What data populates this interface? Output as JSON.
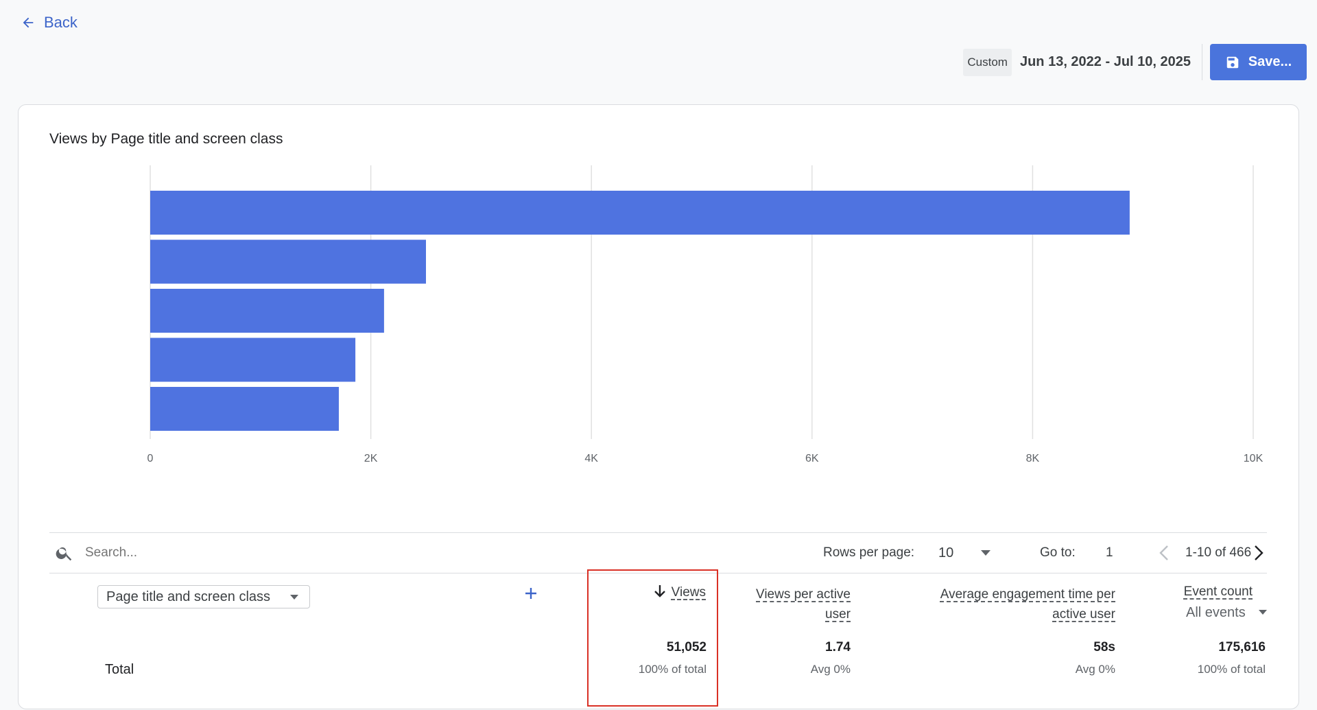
{
  "nav": {
    "back_label": "Back"
  },
  "header": {
    "date_chip": "Custom",
    "date_range": "Jun 13, 2022 - Jul 10, 2025",
    "save_label": "Save..."
  },
  "colors": {
    "accent": "#4a74dc",
    "bar": "#4f73e0",
    "highlight_border": "#d93025"
  },
  "chart_data": {
    "type": "bar",
    "orientation": "horizontal",
    "title": "Views by Page title and screen class",
    "categories": [
      "",
      "",
      "",
      "",
      ""
    ],
    "values": [
      8880,
      2500,
      2120,
      1860,
      1710
    ],
    "xlim": [
      0,
      10000
    ],
    "xticks": [
      0,
      2000,
      4000,
      6000,
      8000,
      10000
    ],
    "xtick_labels": [
      "0",
      "2K",
      "4K",
      "6K",
      "8K",
      "10K"
    ],
    "grid": true
  },
  "table": {
    "search_placeholder": "Search...",
    "rows_per_page_label": "Rows per page:",
    "rows_per_page_value": "10",
    "goto_label": "Go to:",
    "goto_value": "1",
    "pagination_text": "1-10 of 466",
    "dimension_select": "Page title and screen class",
    "metrics": {
      "views": "Views",
      "views_per_user_line1": "Views per active",
      "views_per_user_line2": "user",
      "engagement_line1": "Average engagement time per",
      "engagement_line2": "active user",
      "event_count": "Event count",
      "event_filter": "All events"
    },
    "totals": {
      "label": "Total",
      "views": "51,052",
      "views_sub": "100% of total",
      "views_per_user": "1.74",
      "views_per_user_sub": "Avg 0%",
      "engagement": "58s",
      "engagement_sub": "Avg 0%",
      "event_count": "175,616",
      "event_count_sub": "100% of total"
    }
  }
}
